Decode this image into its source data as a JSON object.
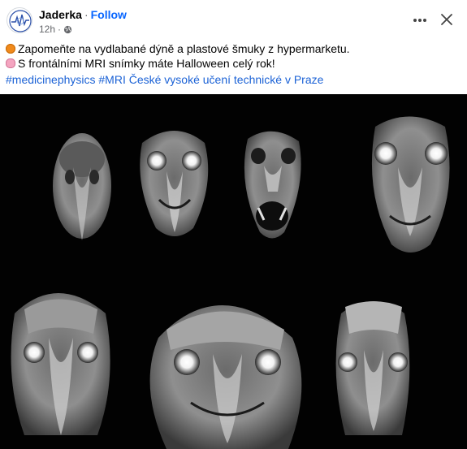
{
  "author": {
    "name": "Jaderka",
    "follow_label": "Follow",
    "time": "12h",
    "separator": "·",
    "audience_icon": "globe-icon"
  },
  "post": {
    "line1": "Zapomeňte na vydlabané dýně a plastové šmuky z hypermarketu.",
    "line2": "S frontálními MRI snímky máte Halloween celý rok!",
    "line1_emoji": "pumpkin",
    "line2_emoji": "brain",
    "hashtags": [
      "#medicinephysics",
      "#MRI",
      "České vysoké učení technické v Praze"
    ]
  },
  "icons": {
    "more": "more-horizontal-icon",
    "close": "close-icon"
  },
  "colors": {
    "link": "#0866ff",
    "hashtag": "#1b62d6",
    "muted": "#65676b",
    "image_bg": "#020202"
  }
}
